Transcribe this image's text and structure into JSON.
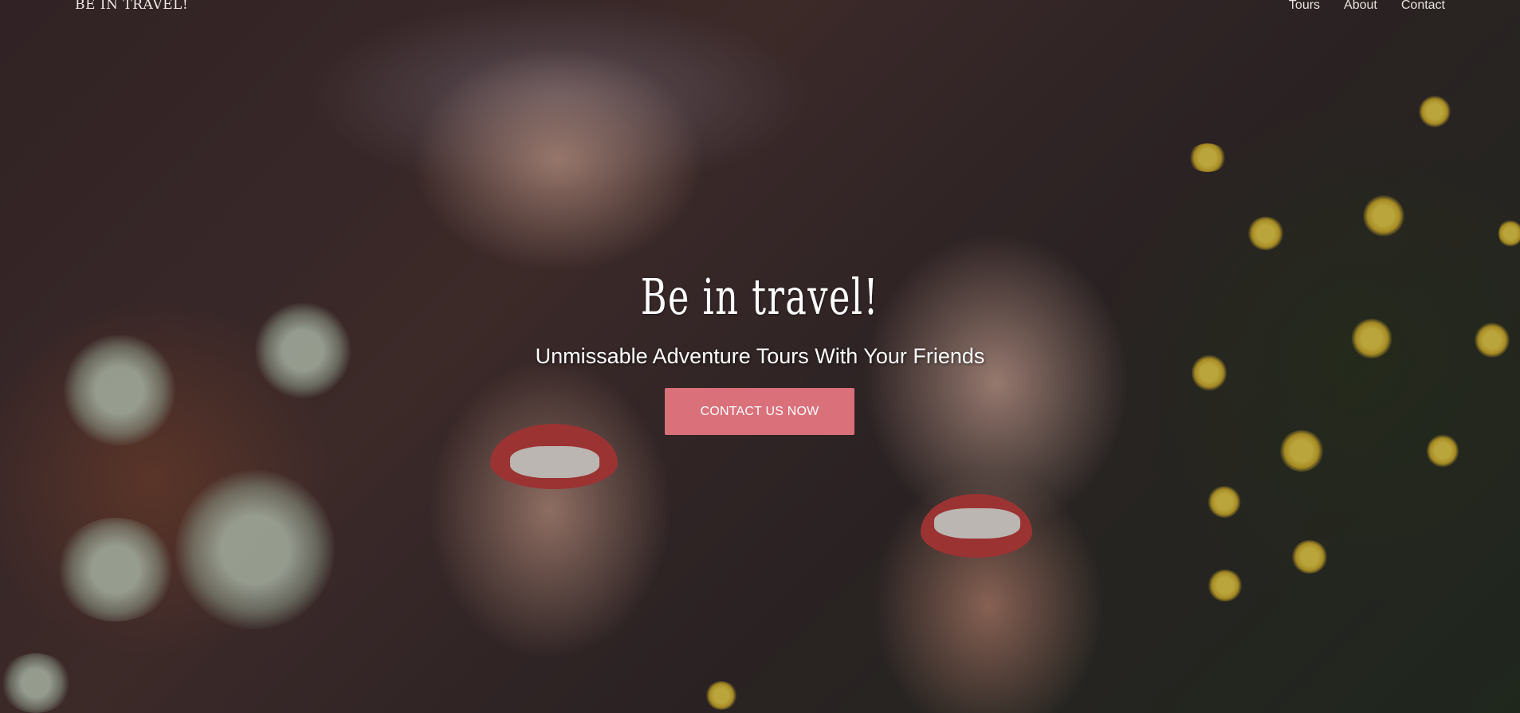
{
  "nav": {
    "brand": "Be in travel!",
    "links": [
      {
        "label": "Tours"
      },
      {
        "label": "About"
      },
      {
        "label": "Contact"
      }
    ]
  },
  "hero": {
    "title": "Be in travel!",
    "subtitle": "Unmissable Adventure Tours With Your Friends",
    "cta_label": "CONTACT US NOW"
  },
  "colors": {
    "cta_background": "#d9707a",
    "text": "#ffffff"
  }
}
